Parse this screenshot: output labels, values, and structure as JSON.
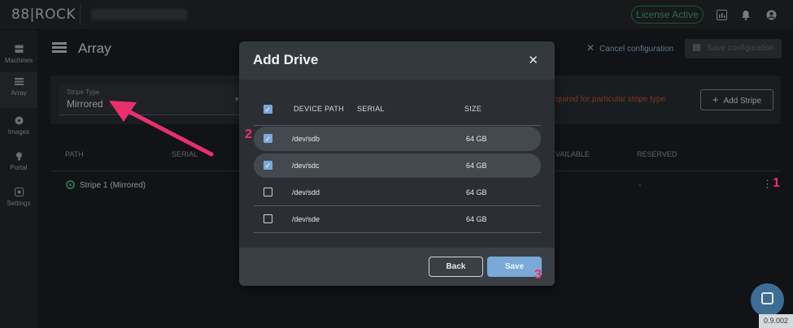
{
  "topbar": {
    "logo": "88|ROCK",
    "license": "License Active",
    "icons": [
      "chart-icon",
      "bell-icon",
      "user-icon"
    ]
  },
  "sidenav": [
    {
      "label": "Machines",
      "icon": "server-icon"
    },
    {
      "label": "Array",
      "icon": "list-icon",
      "active": true
    },
    {
      "label": "Images",
      "icon": "disc-icon"
    },
    {
      "label": "Portal",
      "icon": "bulb-icon"
    },
    {
      "label": "Settings",
      "icon": "gear-icon"
    }
  ],
  "page": {
    "title": "Array",
    "cancel_config": "Cancel configuration",
    "save_config": "Save configuration"
  },
  "stripe": {
    "label": "Stripe Type",
    "value": "Mirrored",
    "requirement_text": "quired for particular stripe type",
    "add_stripe": "Add Stripe"
  },
  "table": {
    "headers": {
      "path": "PATH",
      "serial": "SERIAL",
      "available": "VAILABLE",
      "reserved": "RESERVED"
    },
    "rows": [
      {
        "name": "Stripe 1 (Mirrored)",
        "reserved": "-"
      }
    ]
  },
  "modal": {
    "title": "Add Drive",
    "headers": {
      "device_path": "DEVICE PATH",
      "serial": "SERIAL",
      "size": "SIZE"
    },
    "rows": [
      {
        "path": "/dev/sdb",
        "serial": "",
        "size": "64 GB",
        "checked": true
      },
      {
        "path": "/dev/sdc",
        "serial": "",
        "size": "64 GB",
        "checked": true
      },
      {
        "path": "/dev/sdd",
        "serial": "",
        "size": "64 GB",
        "checked": false
      },
      {
        "path": "/dev/sde",
        "serial": "",
        "size": "64 GB",
        "checked": false
      }
    ],
    "back": "Back",
    "save": "Save"
  },
  "annotations": {
    "step1": "1",
    "step2": "2",
    "step3": "3",
    "color": "#e8316c"
  },
  "version": "0.9.002"
}
